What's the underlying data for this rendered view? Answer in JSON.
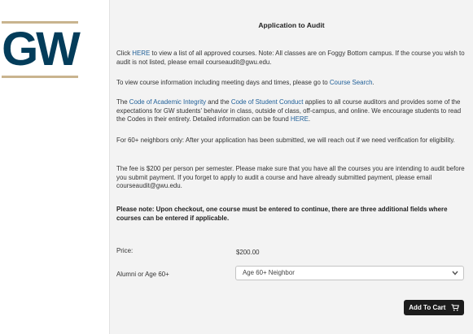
{
  "logo": {
    "text": "GW",
    "brand_color": "#033c5a",
    "accent_color": "#c9b48f"
  },
  "panel": {
    "title": "Application to Audit",
    "p1": {
      "pre": "Click ",
      "link": "HERE",
      "post": " to view a list of all approved courses.  Note: All classes are on Foggy Bottom campus. If the course you wish to audit is not listed, please email courseaudit@gwu.edu."
    },
    "p2": {
      "pre": "To view course information including meeting days and times, please go to ",
      "link": "Course Search",
      "post": "."
    },
    "p3": {
      "pre": "The ",
      "link1": "Code of Academic Integrity",
      "mid1": " and the ",
      "link2": "Code of Student Conduct",
      "mid2": " applies to all course auditors and provides some of the expectations for GW students' behavior in class, outside of class, off-campus, and online. We encourage students to read the Codes in their entirety.  Detailed information can be found ",
      "link3": "HERE",
      "post": "."
    },
    "p4": "For 60+ neighbors only:  After your application has been submitted, we will reach out if we need verification for eligibility.",
    "p5": "The fee is $200 per person per semester.  Please make sure that you have all the courses you are intending to audit before you submit payment.  If you forget to apply to audit a course and have already submitted payment, please email courseaudit@gwu.edu.",
    "p6": "Please note: Upon checkout, one course must be entered to continue, there are three additional fields where courses can be entered if applicable."
  },
  "form": {
    "price_label": "Price:",
    "price_value": "$200.00",
    "alumni_label": "Alumni or Age 60+",
    "alumni_selected": "Age 60+ Neighbor",
    "add_to_cart": "Add To Cart"
  },
  "icons": {
    "select": "chevron-down-icon",
    "cart": "cart-icon"
  },
  "colors": {
    "link": "#1f5f98",
    "button_bg": "#1c1c1c",
    "panel_bg": "#f3f3f3"
  }
}
